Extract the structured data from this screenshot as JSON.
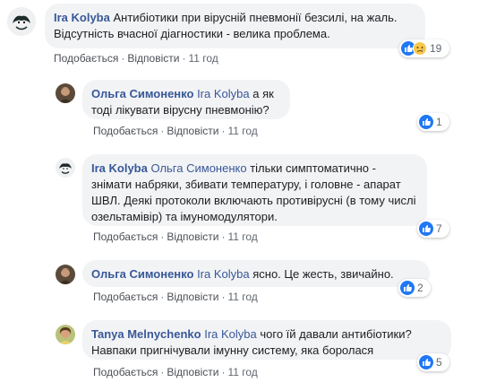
{
  "comments": [
    {
      "author": "Ira Kolyba",
      "mention": "",
      "text": "Антибіотики при вірусній пневмонії безсилі, на жаль. Відсутність вчасної діагностики - велика проблема.",
      "like_label": "Подобається",
      "reply_label": "Відповісти",
      "time": "11 год",
      "reactions": [
        "like",
        "sad"
      ],
      "count": "19"
    },
    {
      "author": "Ольга Симоненко",
      "mention": "Ira Kolyba",
      "text": "а як тоді лікувати вірусну пневмонію?",
      "like_label": "Подобається",
      "reply_label": "Відповісти",
      "time": "11 год",
      "reactions": [
        "like"
      ],
      "count": "1"
    },
    {
      "author": "Ira Kolyba",
      "mention": "Ольга Симоненко",
      "text": "тільки симптоматично - знімати набряки, збивати температуру, і головне - апарат ШВЛ. Деякі протоколи включають противірусні (в тому числі озельтамівір) та імуномодулятори.",
      "like_label": "Подобається",
      "reply_label": "Відповісти",
      "time": "11 год",
      "reactions": [
        "like"
      ],
      "count": "7"
    },
    {
      "author": "Ольга Симоненко",
      "mention": "Ira Kolyba",
      "text": "ясно. Це жесть, звичайно.",
      "like_label": "Подобається",
      "reply_label": "Відповісти",
      "time": "11 год",
      "reactions": [
        "like"
      ],
      "count": "2"
    },
    {
      "author": "Tanya Melnychenko",
      "mention": "Ira Kolyba",
      "text": "чого їй давали антибіотики? Навпаки пригнічували імунну систему, яка боролася",
      "like_label": "Подобається",
      "reply_label": "Відповісти",
      "time": "11 год",
      "reactions": [
        "like"
      ],
      "count": "5"
    }
  ],
  "colors": {
    "name": "#385898",
    "bubble": "#f2f3f5",
    "like": "#2078f4"
  }
}
